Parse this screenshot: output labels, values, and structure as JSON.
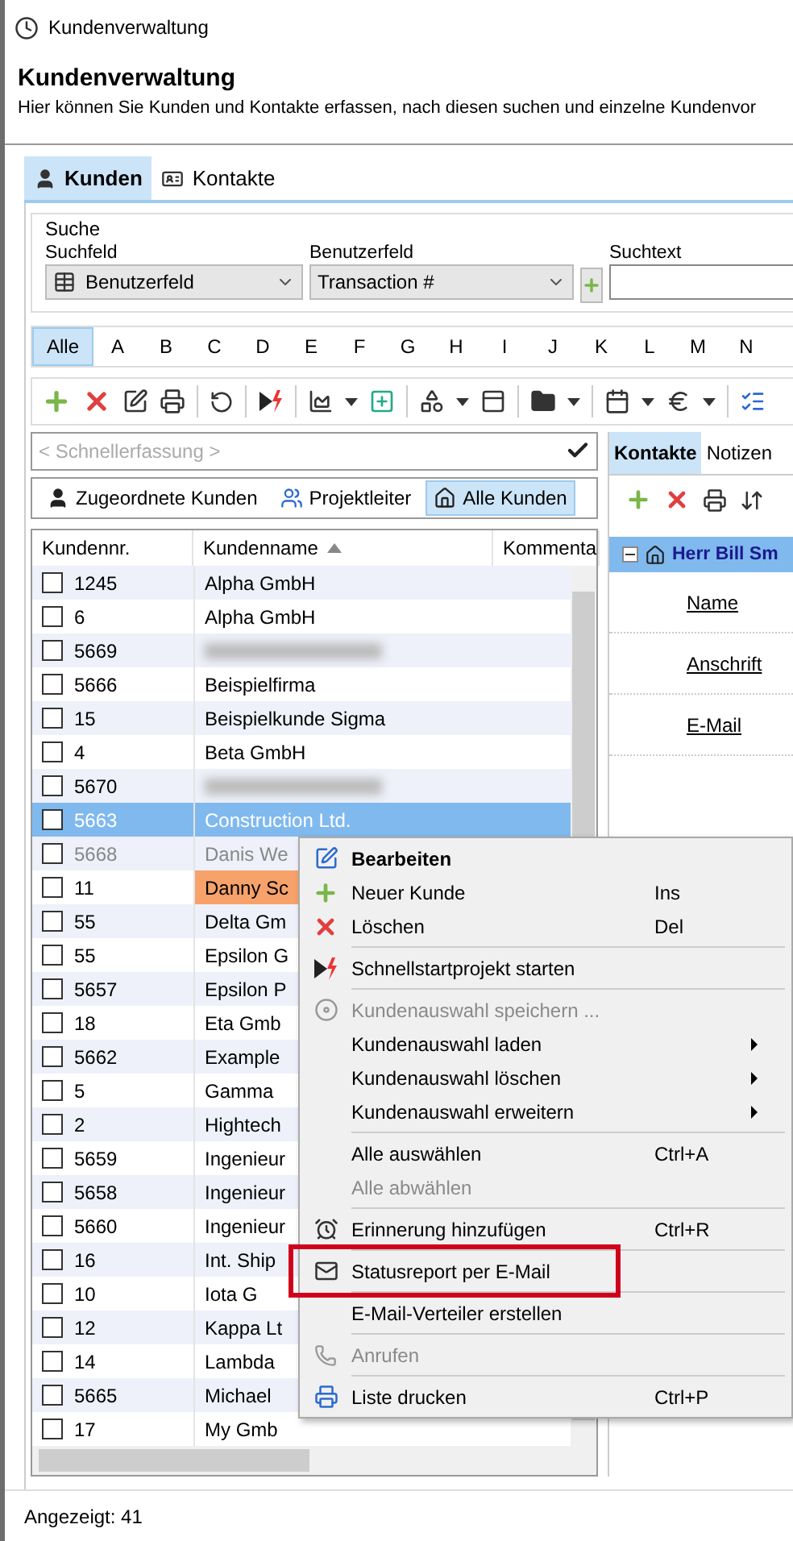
{
  "window": {
    "title": "Kundenverwaltung"
  },
  "header": {
    "title": "Kundenverwaltung",
    "description": "Hier können Sie Kunden und Kontakte erfassen, nach diesen suchen und einzelne Kundenvor"
  },
  "tabs": [
    {
      "label": "Kunden",
      "selected": true
    },
    {
      "label": "Kontakte",
      "selected": false
    }
  ],
  "search": {
    "legend": "Suche",
    "search_field": {
      "label": "Suchfeld",
      "value": "Benutzerfeld"
    },
    "user_field": {
      "label": "Benutzerfeld",
      "value": "Transaction #"
    },
    "text_field": {
      "label": "Suchtext"
    }
  },
  "alphabet": [
    {
      "label": "Alle",
      "selected": true
    },
    {
      "label": "A",
      "selected": false
    },
    {
      "label": "B",
      "selected": false
    },
    {
      "label": "C",
      "selected": false
    },
    {
      "label": "D",
      "selected": false
    },
    {
      "label": "E",
      "selected": false
    },
    {
      "label": "F",
      "selected": false
    },
    {
      "label": "G",
      "selected": false
    },
    {
      "label": "H",
      "selected": false
    },
    {
      "label": "I",
      "selected": false
    },
    {
      "label": "J",
      "selected": false
    },
    {
      "label": "K",
      "selected": false
    },
    {
      "label": "L",
      "selected": false
    },
    {
      "label": "M",
      "selected": false
    },
    {
      "label": "N",
      "selected": false
    }
  ],
  "quick_entry": {
    "placeholder": "< Schnellerfassung >"
  },
  "filters": [
    {
      "label": "Zugeordnete Kunden",
      "selected": false
    },
    {
      "label": "Projektleiter",
      "selected": false
    },
    {
      "label": "Alle Kunden",
      "selected": true
    }
  ],
  "table": {
    "columns": [
      {
        "label": "Kundennr."
      },
      {
        "label": "Kundenname",
        "sorted": true
      },
      {
        "label": "Kommenta"
      }
    ],
    "rows": [
      {
        "number": "1245",
        "name": "Alpha GmbH",
        "checked": false,
        "selected": false
      },
      {
        "number": "6",
        "name": "Alpha GmbH",
        "checked": false,
        "selected": false
      },
      {
        "number": "5669",
        "checked": false,
        "selected": false,
        "blurred": true
      },
      {
        "number": "5666",
        "name": "Beispielfirma",
        "checked": false,
        "selected": false
      },
      {
        "number": "15",
        "name": "Beispielkunde Sigma",
        "checked": false,
        "selected": false
      },
      {
        "number": "4",
        "name": "Beta GmbH",
        "checked": false,
        "selected": false
      },
      {
        "number": "5670",
        "checked": false,
        "selected": false,
        "blurred": true
      },
      {
        "number": "5663",
        "name": "Construction Ltd.",
        "checked": false,
        "selected": true
      },
      {
        "number": "5668",
        "name": "Danis We",
        "checked": false,
        "selected": false,
        "inactive": true
      },
      {
        "number": "11",
        "name": "Danny Sc",
        "checked": false,
        "selected": false,
        "highlighted": true
      },
      {
        "number": "55",
        "name": "Delta Gm",
        "checked": false,
        "selected": false
      },
      {
        "number": "55",
        "name": "Epsilon G",
        "checked": false,
        "selected": false
      },
      {
        "number": "5657",
        "name": "Epsilon P",
        "checked": false,
        "selected": false
      },
      {
        "number": "18",
        "name": "Eta Gmb",
        "checked": false,
        "selected": false
      },
      {
        "number": "5662",
        "name": "Example",
        "checked": false,
        "selected": false
      },
      {
        "number": "5",
        "name": "Gamma",
        "checked": false,
        "selected": false
      },
      {
        "number": "2",
        "name": "Hightech",
        "checked": false,
        "selected": false
      },
      {
        "number": "5659",
        "name": "Ingenieur",
        "checked": false,
        "selected": false
      },
      {
        "number": "5658",
        "name": "Ingenieur",
        "checked": false,
        "selected": false
      },
      {
        "number": "5660",
        "name": "Ingenieur",
        "checked": false,
        "selected": false
      },
      {
        "number": "16",
        "name": "Int. Ship",
        "checked": false,
        "selected": false
      },
      {
        "number": "10",
        "name": "Iota G",
        "checked": false,
        "selected": false
      },
      {
        "number": "12",
        "name": "Kappa Lt",
        "checked": false,
        "selected": false
      },
      {
        "number": "14",
        "name": "Lambda",
        "checked": false,
        "selected": false
      },
      {
        "number": "5665",
        "name": "Michael",
        "checked": false,
        "selected": false
      },
      {
        "number": "17",
        "name": "My Gmb",
        "checked": false,
        "selected": false
      }
    ]
  },
  "contact_panel": {
    "tabs": [
      {
        "label": "Kontakte",
        "selected": true
      },
      {
        "label": "Notizen",
        "selected": false
      }
    ],
    "contact": {
      "name": "Herr Bill Sm",
      "expanded": true,
      "selected": true
    },
    "fields": [
      "Name",
      "Anschrift",
      "E-Mail"
    ]
  },
  "context_menu": {
    "items": [
      {
        "kind": "item",
        "label": "Bearbeiten",
        "default": true,
        "disabled": false
      },
      {
        "kind": "item",
        "label": "Neuer Kunde",
        "shortcut": "Ins",
        "disabled": false
      },
      {
        "kind": "item",
        "label": "Löschen",
        "shortcut": "Del",
        "disabled": false
      },
      {
        "kind": "separator"
      },
      {
        "kind": "item",
        "label": "Schnellstartprojekt starten",
        "disabled": false
      },
      {
        "kind": "separator"
      },
      {
        "kind": "item",
        "label": "Kundenauswahl speichern ...",
        "disabled": true
      },
      {
        "kind": "item",
        "label": "Kundenauswahl laden",
        "disabled": false,
        "submenu": true
      },
      {
        "kind": "item",
        "label": "Kundenauswahl löschen",
        "disabled": false,
        "submenu": true
      },
      {
        "kind": "item",
        "label": "Kundenauswahl erweitern",
        "disabled": false,
        "submenu": true
      },
      {
        "kind": "separator"
      },
      {
        "kind": "item",
        "label": "Alle auswählen",
        "shortcut": "Ctrl+A",
        "disabled": false
      },
      {
        "kind": "item",
        "label": "Alle abwählen",
        "disabled": true
      },
      {
        "kind": "separator"
      },
      {
        "kind": "item",
        "label": "Erinnerung hinzufügen",
        "shortcut": "Ctrl+R",
        "disabled": false
      },
      {
        "kind": "separator"
      },
      {
        "kind": "item",
        "label": "Statusreport per E-Mail",
        "disabled": false,
        "emphasized": true
      },
      {
        "kind": "separator"
      },
      {
        "kind": "item",
        "label": "E-Mail-Verteiler erstellen",
        "disabled": false
      },
      {
        "kind": "separator"
      },
      {
        "kind": "item",
        "label": "Anrufen",
        "disabled": true
      },
      {
        "kind": "separator"
      },
      {
        "kind": "item",
        "label": "Liste drucken",
        "shortcut": "Ctrl+P",
        "disabled": false
      }
    ]
  },
  "status_bar": {
    "count": "Angezeigt: 41"
  }
}
